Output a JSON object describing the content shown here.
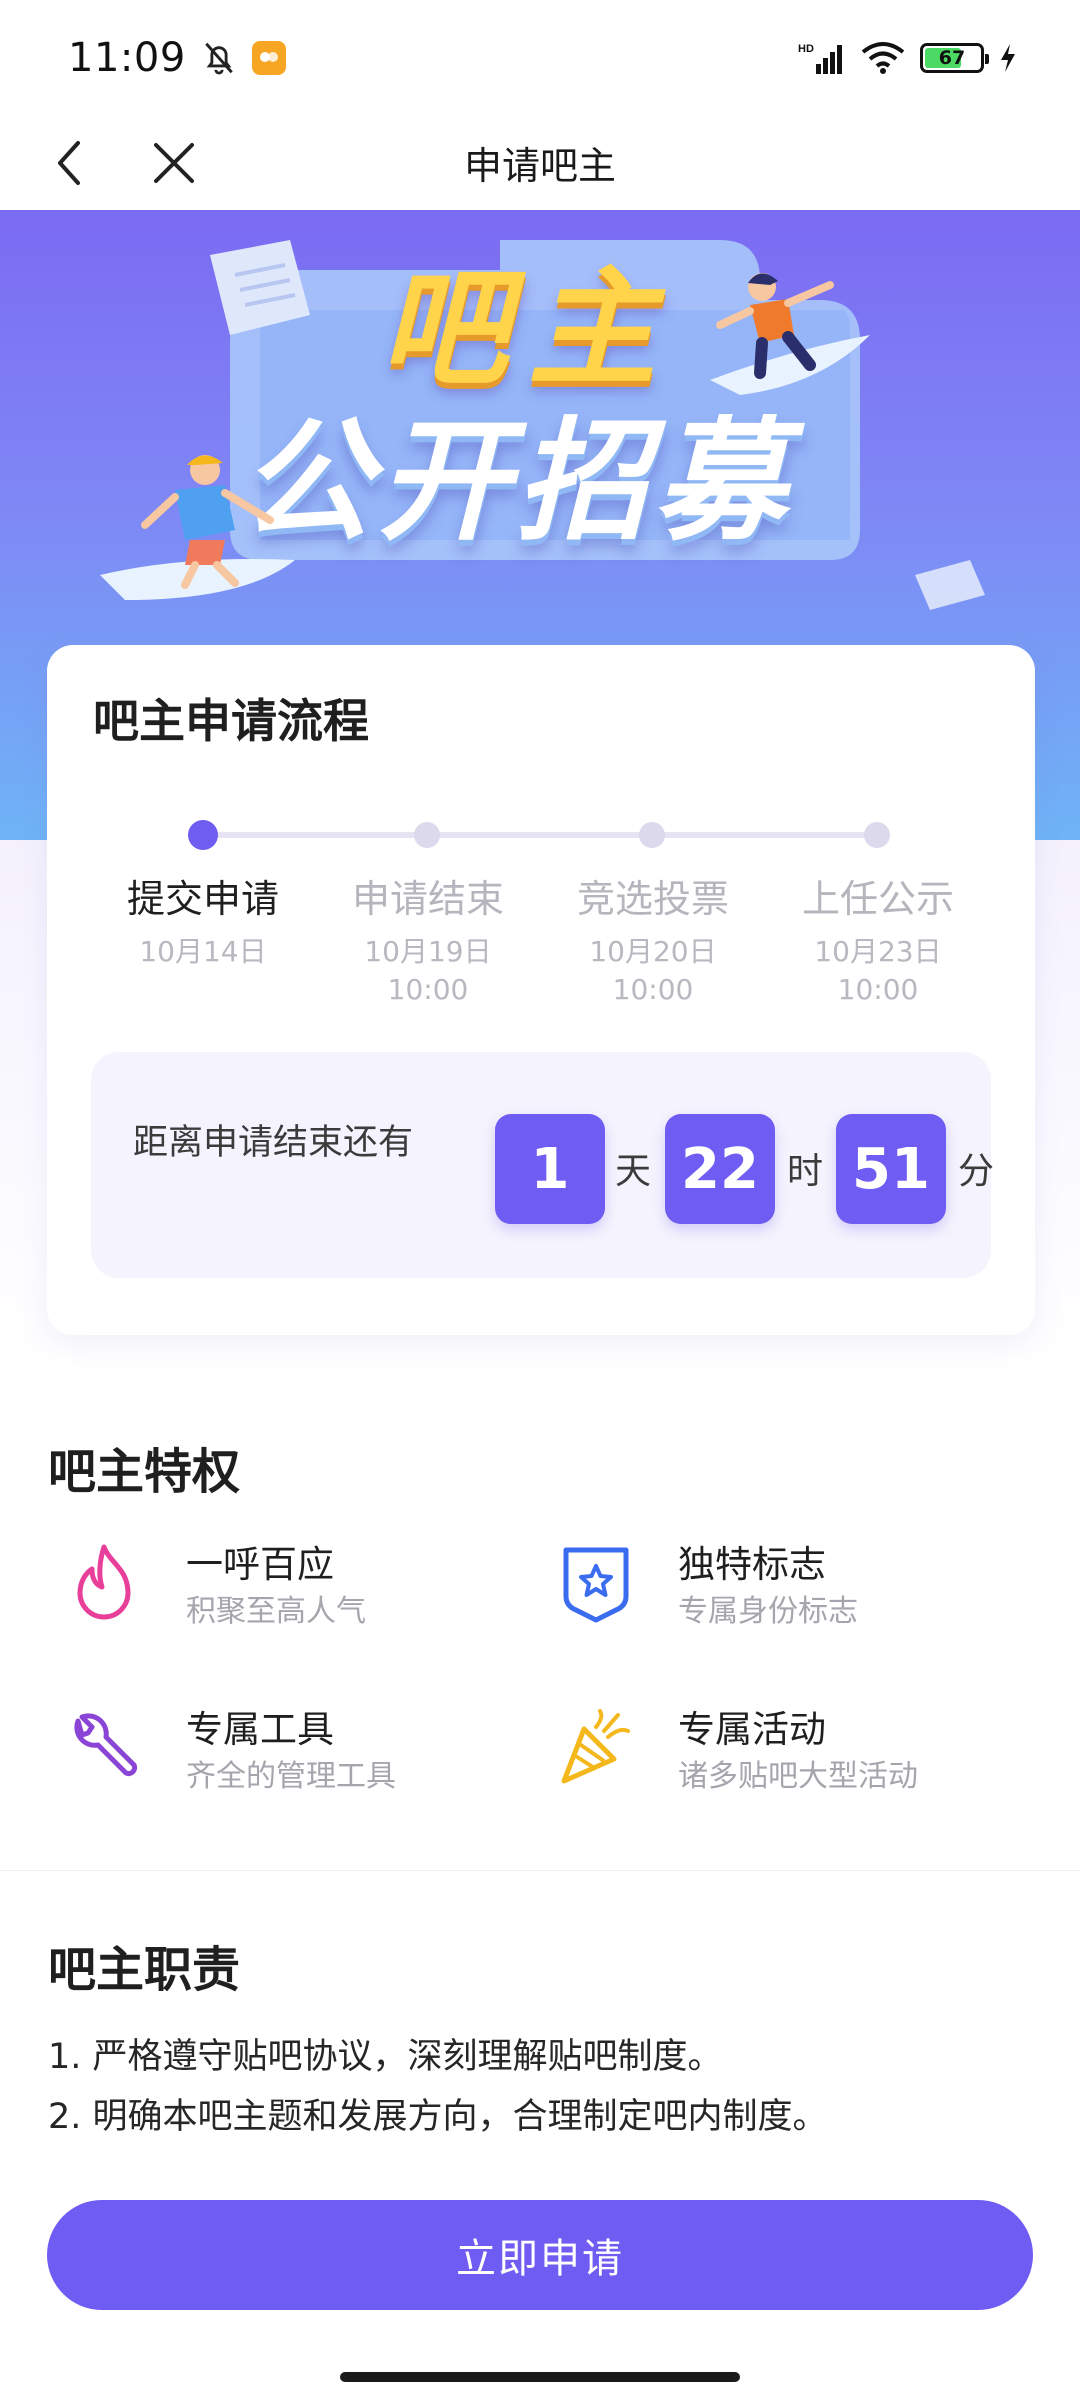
{
  "status_bar": {
    "time": "11:09",
    "battery": "67",
    "icons": [
      "bell-off-icon",
      "app-badge-icon",
      "hd-signal-icon",
      "wifi-icon",
      "battery-icon",
      "charging-icon"
    ]
  },
  "nav": {
    "title": "申请吧主"
  },
  "banner": {
    "line1": "吧主",
    "line2": "公开招募"
  },
  "process": {
    "title": "吧主申请流程",
    "steps": [
      {
        "name": "提交申请",
        "date": "10月14日",
        "time": ""
      },
      {
        "name": "申请结束",
        "date": "10月19日",
        "time": "10:00"
      },
      {
        "name": "竞选投票",
        "date": "10月20日",
        "time": "10:00"
      },
      {
        "name": "上任公示",
        "date": "10月23日",
        "time": "10:00"
      }
    ],
    "current_step": 1,
    "countdown": {
      "label": "距离申请结束还有",
      "days": "1",
      "day_unit": "天",
      "hours": "22",
      "hour_unit": "时",
      "minutes": "51",
      "minute_unit": "分"
    }
  },
  "privileges": {
    "title": "吧主特权",
    "items": [
      {
        "title": "一呼百应",
        "subtitle": "积聚至高人气",
        "icon": "flame-icon",
        "color": "#e8409a"
      },
      {
        "title": "独特标志",
        "subtitle": "专属身份标志",
        "icon": "star-badge-icon",
        "color": "#3a6cf0"
      },
      {
        "title": "专属工具",
        "subtitle": "齐全的管理工具",
        "icon": "wrench-icon",
        "color": "#8b45d6"
      },
      {
        "title": "专属活动",
        "subtitle": "诸多贴吧大型活动",
        "icon": "party-popper-icon",
        "color": "#f5b81c"
      }
    ]
  },
  "duties": {
    "title": "吧主职责",
    "items": [
      "1. 严格遵守贴吧协议，深刻理解贴吧制度。",
      "2. 明确本吧主题和发展方向，合理制定吧内制度。"
    ]
  },
  "apply_button": "立即申请",
  "colors": {
    "accent": "#6e5cf3",
    "banner_top": "#7b6bf2",
    "banner_bottom": "#6fb4f6"
  }
}
